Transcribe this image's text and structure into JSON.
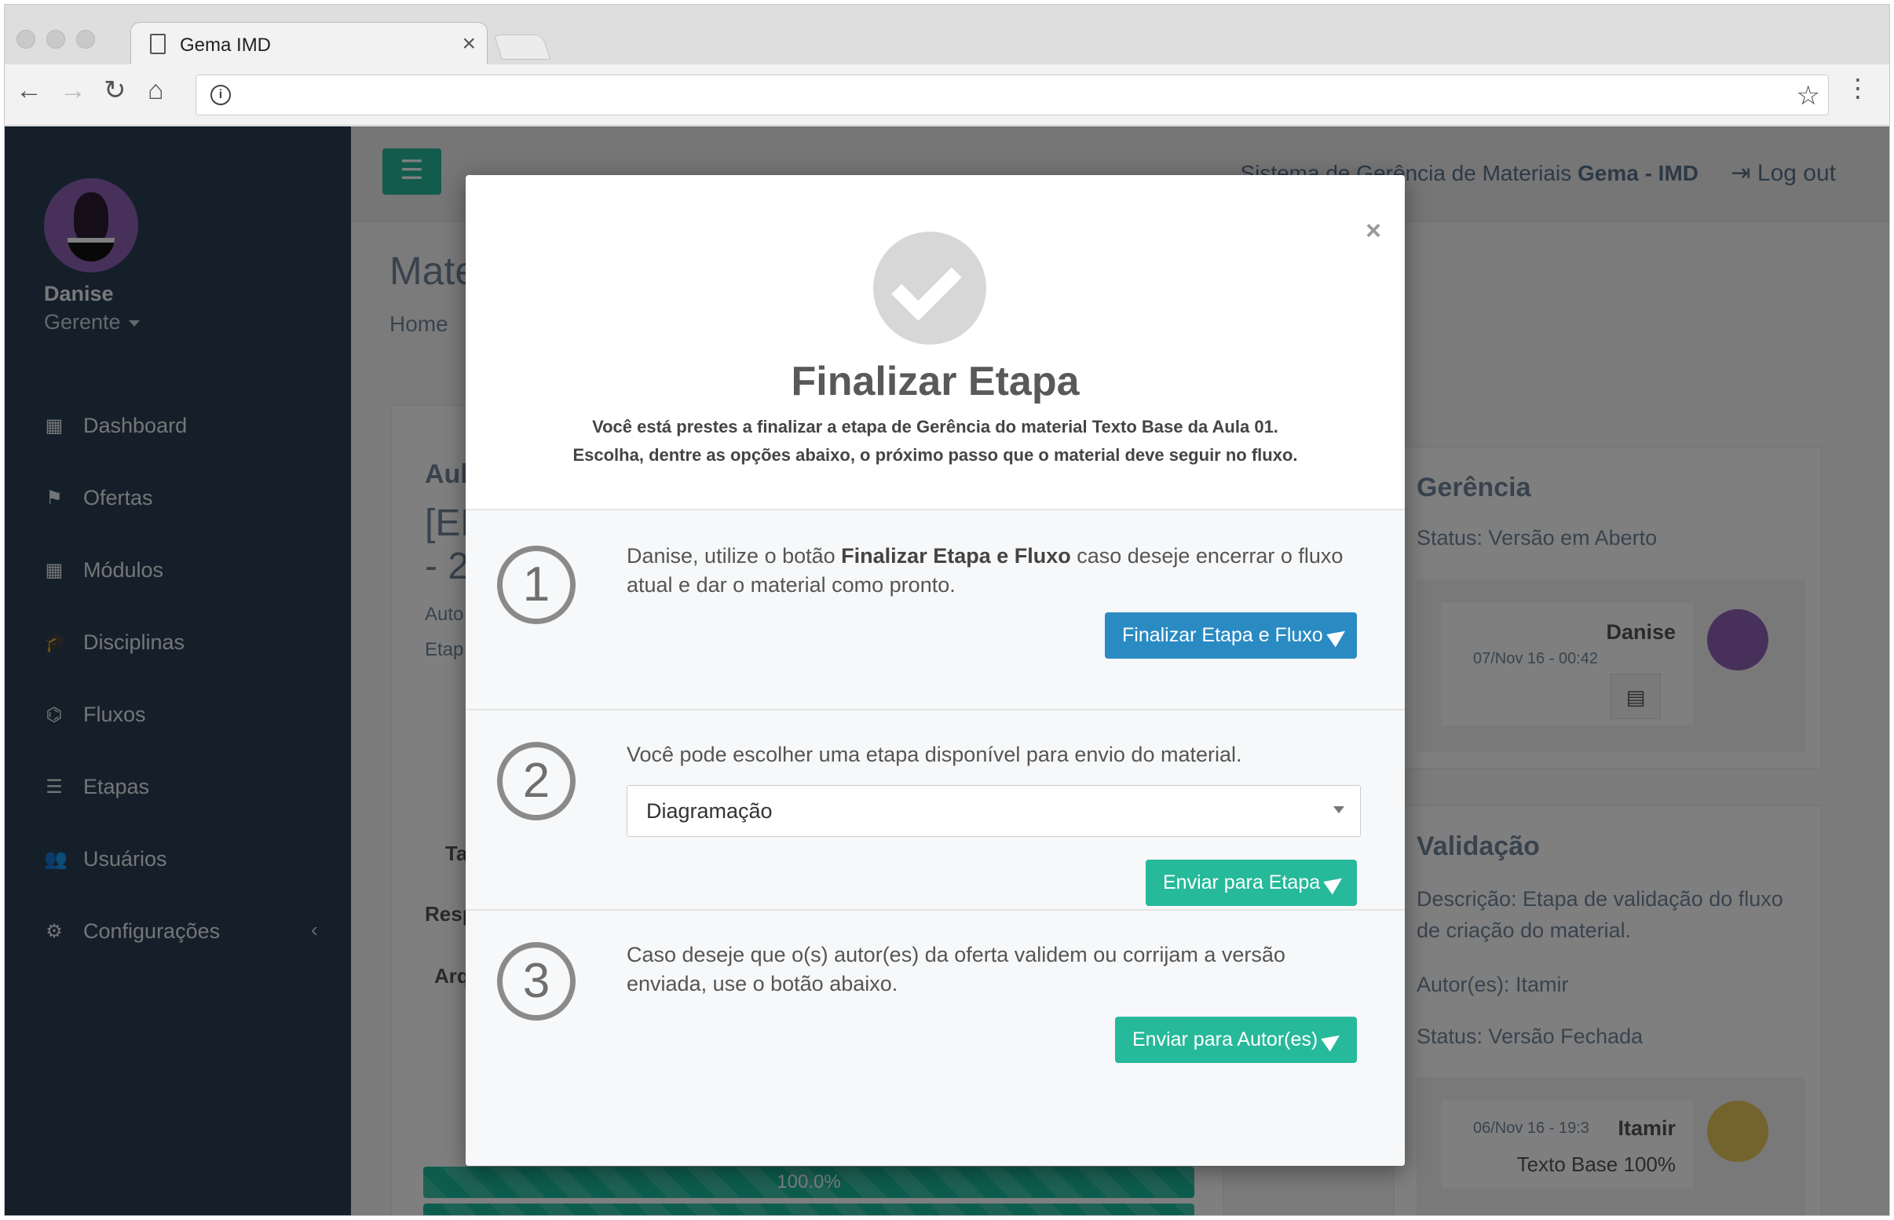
{
  "browser": {
    "tab_title": "Gema IMD",
    "url": "",
    "tab_close": "×"
  },
  "sidebar": {
    "user_name": "Danise",
    "user_role": "Gerente",
    "items": [
      {
        "label": "Dashboard",
        "icon": "dashboard-icon",
        "glyph": "▦"
      },
      {
        "label": "Ofertas",
        "icon": "signs-icon",
        "glyph": "⚑"
      },
      {
        "label": "Módulos",
        "icon": "grid-icon",
        "glyph": "▦"
      },
      {
        "label": "Disciplinas",
        "icon": "graduation-cap-icon",
        "glyph": "🎓"
      },
      {
        "label": "Fluxos",
        "icon": "sitemap-icon",
        "glyph": "⌬"
      },
      {
        "label": "Etapas",
        "icon": "list-icon",
        "glyph": "☰"
      },
      {
        "label": "Usuários",
        "icon": "users-icon",
        "glyph": "👥"
      },
      {
        "label": "Configurações",
        "icon": "gears-icon",
        "glyph": "⚙"
      }
    ]
  },
  "topnav": {
    "system_title_prefix": "Sistema de Gerência de Materiais ",
    "system_title_bold": "Gema - IMD",
    "logout": "Log out"
  },
  "background": {
    "page_title": "Mate",
    "breadcrumb": "Home",
    "left_panel_heading": "Aul",
    "left_panel_line1": "[ED",
    "left_panel_line2": "- 2",
    "left_panel_autor": "Auto",
    "left_panel_etapa": "Etap",
    "label_ta": "Ta",
    "label_resp": "Resp",
    "label_arq": "Arq",
    "progress_label": "100.0%",
    "gerencia": {
      "title": "Gerência",
      "status": "Status: Versão em Aberto",
      "author": "Danise",
      "date": "07/Nov 16 - 00:42"
    },
    "validacao": {
      "title": "Validação",
      "description": "Descrição: Etapa de validação do fluxo de criação do material.",
      "authors": "Autor(es): Itamir",
      "status": "Status: Versão Fechada",
      "author": "Itamir",
      "date": "06/Nov 16 - 19:3",
      "file": "Texto Base 100%"
    }
  },
  "modal": {
    "close": "×",
    "title": "Finalizar Etapa",
    "subtitle_line1": "Você está prestes a finalizar a etapa de Gerência do material Texto Base da Aula 01.",
    "subtitle_line2": "Escolha, dentre as opções abaixo, o próximo passo que o material deve seguir no fluxo.",
    "steps": [
      {
        "number": "1",
        "text_prefix": "Danise, utilize o botão ",
        "text_bold": "Finalizar Etapa e Fluxo",
        "text_suffix": " caso deseje encerrar o fluxo atual e dar o material como pronto.",
        "button": "Finalizar Etapa e Fluxo"
      },
      {
        "number": "2",
        "text": "Você pode escolher uma etapa disponível para envio do material.",
        "select_value": "Diagramação",
        "button": "Enviar para Etapa"
      },
      {
        "number": "3",
        "text": "Caso deseje que o(s) autor(es) da oferta validem ou corrijam a versão enviada, use o botão abaixo.",
        "button": "Enviar para Autor(es)"
      }
    ]
  },
  "colors": {
    "sidebar": "#2a3f54",
    "accent_green": "#26b99a",
    "accent_blue": "#2a8bc3"
  }
}
